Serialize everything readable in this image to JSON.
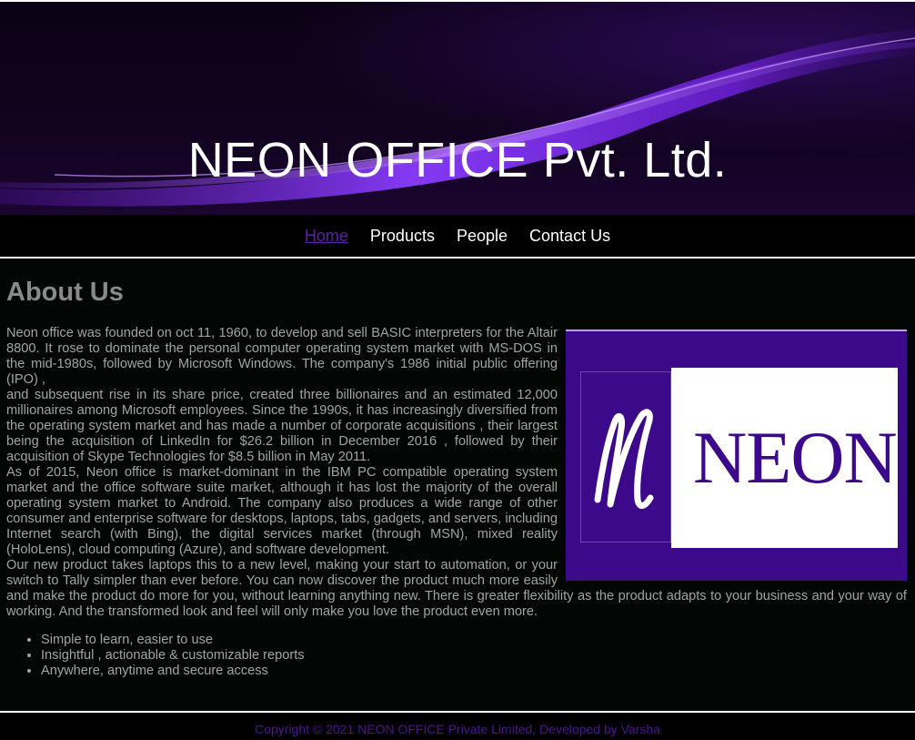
{
  "banner": {
    "title": "NEON OFFICE Pvt. Ltd."
  },
  "nav": {
    "items": [
      {
        "label": "Home",
        "active": true
      },
      {
        "label": "Products",
        "active": false
      },
      {
        "label": "People",
        "active": false
      },
      {
        "label": "Contact Us",
        "active": false
      }
    ]
  },
  "about": {
    "heading": "About Us",
    "paragraphs": [
      "Neon office was founded on oct 11, 1960, to develop and sell BASIC interpreters for the Altair 8800. It rose to dominate the personal computer operating system market with MS-DOS in the mid-1980s, followed by Microsoft Windows. The company's 1986 initial public offering (IPO) ,",
      "and subsequent rise in its share price, created three billionaires and an estimated 12,000 millionaires among Microsoft employees. Since the 1990s, it has increasingly diversified from the operating system market and has made a number of corporate acquisitions , their largest being the acquisition of LinkedIn for $26.2 billion in December 2016 , followed by their acquisition of Skype Technologies for $8.5 billion in May 2011.",
      "As of 2015, Neon office is market-dominant in the IBM PC compatible operating system market and the office software suite market, although it has lost the majority of the overall operating system market to Android. The company also produces a wide range of other consumer and enterprise software for desktops, laptops, tabs, gadgets, and servers, including Internet search (with Bing), the digital services market (through MSN), mixed reality (HoloLens), cloud computing (Azure), and software development.",
      "Our new product takes laptops this to a new level, making your start to automation, or your switch to Tally simpler than ever before. You can now discover the product much more easily and make the product do more for you, without learning anything new. There is greater flexibility as the product adapts to your business and your way of working. And the transformed look and feel will only make you love the product even more."
    ],
    "features": [
      "Simple to learn, easier to use",
      "Insightful , actionable & customizable reports",
      "Anywhere, anytime and secure access"
    ],
    "logo_text": "NEON"
  },
  "footer": {
    "text": "Copyright © 2021 NEON OFFICE Private Limited, Developed by Varsha"
  },
  "colors": {
    "accent": "#5b21a8",
    "logo_purple": "#3b098a",
    "footer_text": "#4b1590",
    "body_text": "#a3a3a3",
    "heading": "#8a8a8a"
  },
  "icons": {
    "list_bullet": "disc-bullet-icon"
  }
}
